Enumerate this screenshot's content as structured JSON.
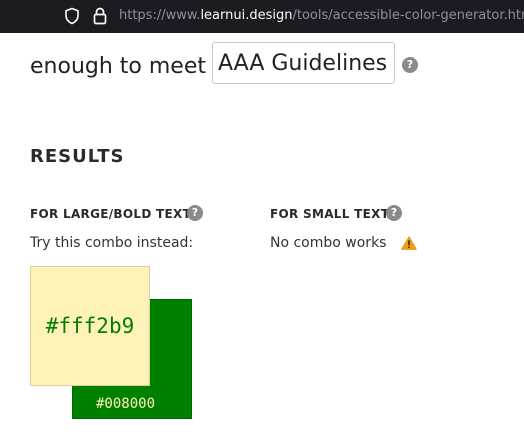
{
  "browser": {
    "url_scheme": "https://www.",
    "url_host": "learnui.design",
    "url_path": "/tools/accessible-color-generator.html",
    "shield_icon": "shield-icon",
    "lock_icon": "lock-icon"
  },
  "form": {
    "meet_text": "enough to meet",
    "guideline_value": "AAA Guidelines",
    "help_icon": "question-icon"
  },
  "results": {
    "heading": "RESULTS",
    "large": {
      "heading": "FOR LARGE/BOLD TEXT",
      "message": "Try this combo instead:"
    },
    "small": {
      "heading": "FOR SMALL TEXT",
      "message": "No combo works",
      "warning_icon": "warning-icon"
    },
    "swatches": {
      "foreground": "#fff2b9",
      "background": "#008000"
    }
  },
  "colors": {
    "chrome_bg": "#1c1b22",
    "foreground_swatch": "#fff2b9",
    "background_swatch": "#008000",
    "warning": "#f0a30a",
    "help_icon": "#8a8a8a"
  }
}
